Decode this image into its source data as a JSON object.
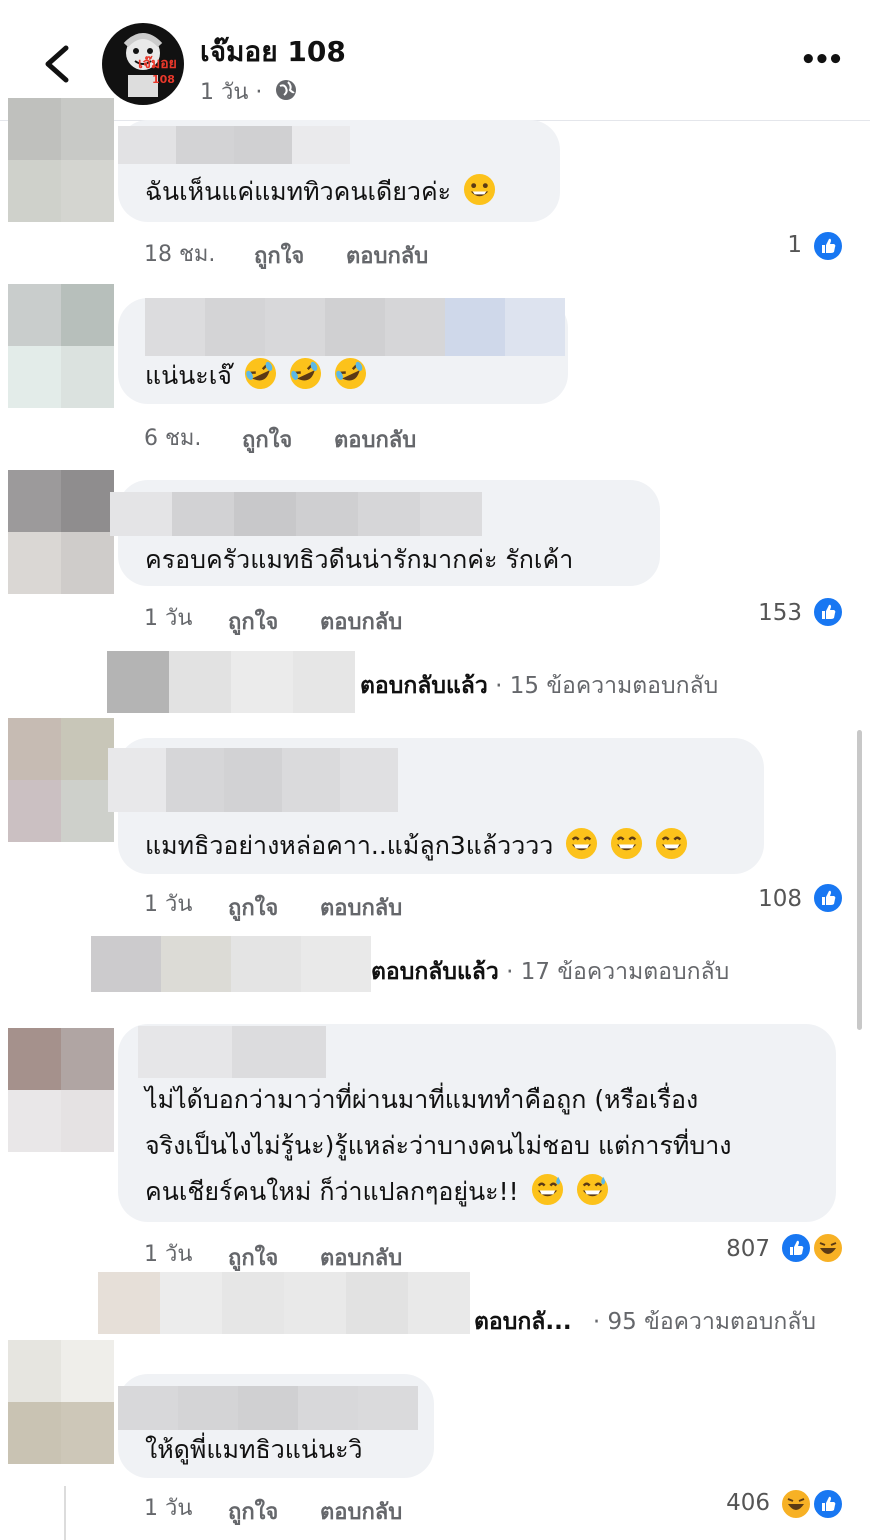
{
  "header": {
    "page_name": "เจ๊มอย 108",
    "time": "1 วัน",
    "separator": "·",
    "avatar_text": "เจ๊มอย",
    "avatar_sub": "108",
    "more": "•••"
  },
  "comments": [
    {
      "text": "ฉันเห็นแค่แมททิวคนเดียวค่ะ",
      "time": "18 ชม.",
      "like": "ถูกใจ",
      "reply": "ตอบกลับ",
      "count": "1"
    },
    {
      "text": "แน่นะเจ๊",
      "time": "6 ชม.",
      "like": "ถูกใจ",
      "reply": "ตอบกลับ",
      "count": ""
    },
    {
      "text": "ครอบครัวแมทธิวดีนน่ารักมากค่ะ รักเค้า",
      "time": "1 วัน",
      "like": "ถูกใจ",
      "reply": "ตอบกลับ",
      "count": "153",
      "reply_summary": {
        "label": "ตอบกลับแล้ว",
        "dot": "·",
        "count": "15 ข้อความตอบกลับ"
      }
    },
    {
      "text": "แมทธิวอย่างหล่อคาา..แม้ลูก3แล้วววว",
      "time": "1 วัน",
      "like": "ถูกใจ",
      "reply": "ตอบกลับ",
      "count": "108",
      "reply_summary": {
        "label": "ตอบกลับแล้ว",
        "dot": "·",
        "count": "17 ข้อความตอบกลับ"
      }
    },
    {
      "lines": [
        "ไม่ได้บอกว่ามาว่าที่ผ่านมาที่แมททำคือถูก (หรือเรื่อง",
        "จริงเป็นไงไม่รู้นะ)รู้แหล่ะว่าบางคนไม่ชอบ แต่การที่บาง",
        "คนเชียร์คนใหม่ ก็ว่าแปลกๆอยู่นะ!!"
      ],
      "time": "1 วัน",
      "like": "ถูกใจ",
      "reply": "ตอบกลับ",
      "count": "807",
      "reply_summary": {
        "label": "ตอบกลั...",
        "dot": "·",
        "count": "95 ข้อความตอบกลับ"
      }
    },
    {
      "text": "ให้ดูพี่แมทธิวแน่นะวิ",
      "time": "1 วัน",
      "like": "ถูกใจ",
      "reply": "ตอบกลับ",
      "count": "406"
    }
  ],
  "colors": {
    "like_blue": "#1877f2",
    "haha_yellow": "#f7b125",
    "bubble_gray": "#f0f2f5",
    "meta_gray": "#65676b"
  }
}
